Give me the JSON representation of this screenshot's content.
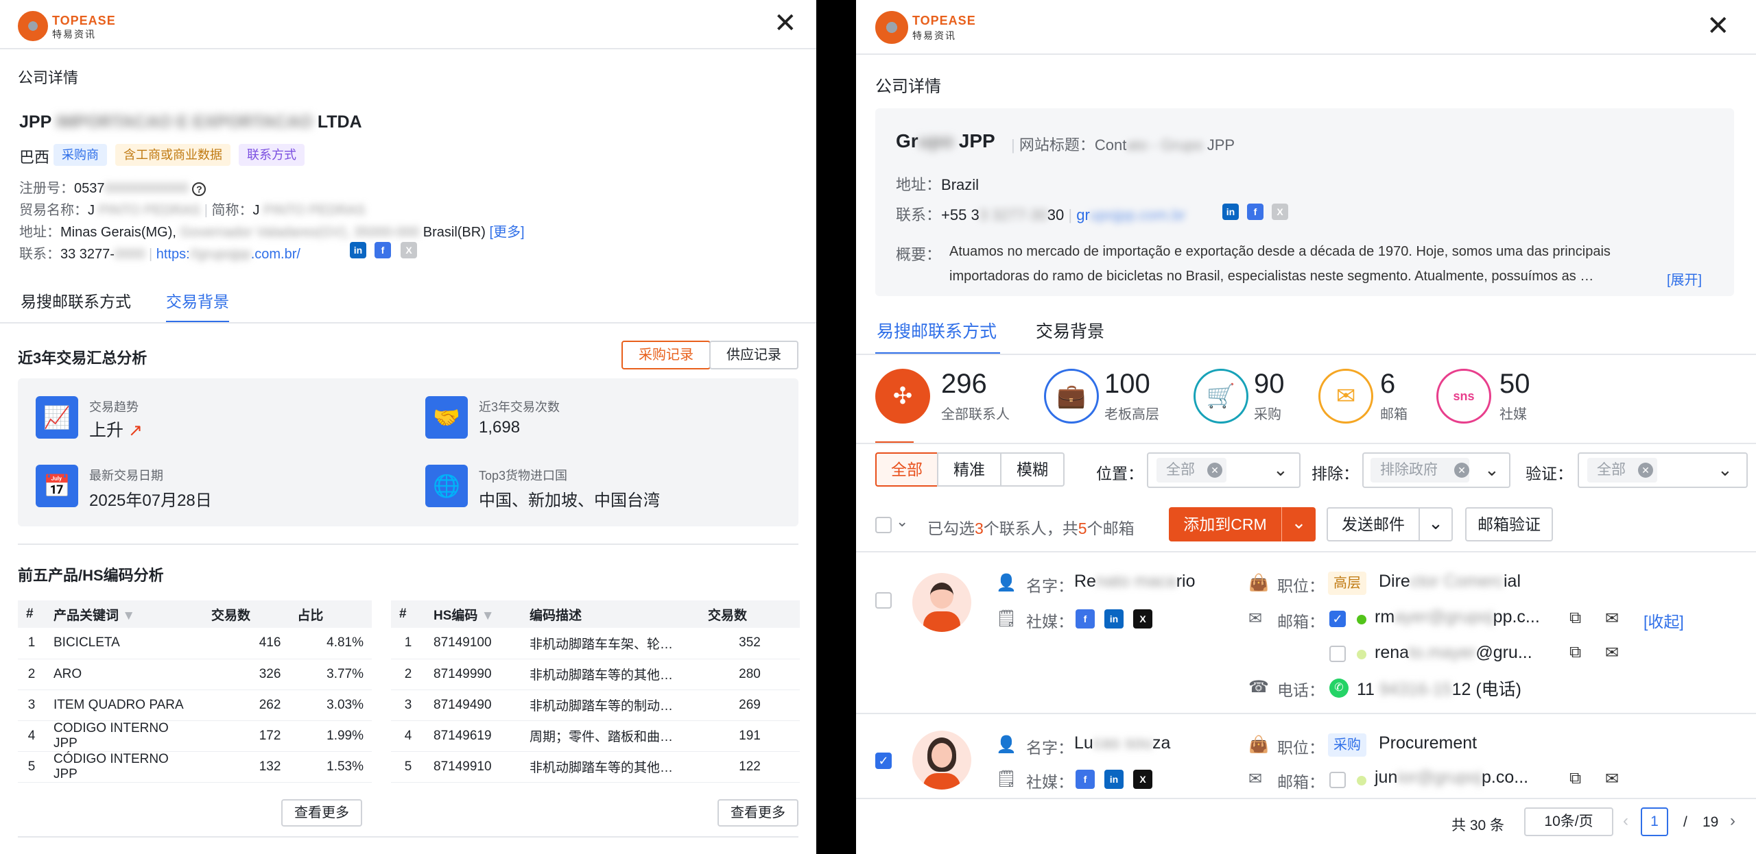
{
  "brand": {
    "name": "TOPEASE",
    "sub": "特易资讯"
  },
  "left": {
    "section_title": "公司详情",
    "company_prefix": "JPP",
    "company_blurred": "IMPORTACAO E EXPORTACAO",
    "company_suffix": "LTDA",
    "country": "巴西",
    "tags": [
      "采购商",
      "含工商或商业数据",
      "联系方式"
    ],
    "reg_label": "注册号：",
    "reg_value": "0537",
    "reg_blur": "00000000000",
    "trade_label": "贸易名称：",
    "trade_value": "J",
    "trade_blur": "PINTO PEDRAS",
    "short_label": "简称：",
    "short_value": "J",
    "short_blur": "PINTO PEDRAS",
    "addr_label": "地址：",
    "addr_value": "Minas Gerais(MG),",
    "addr_blur": "Governador Valadares(GV), 35000-000",
    "addr_country": "Brasil(BR)",
    "addr_more": "[更多]",
    "contact_label": "联系：",
    "contact_phone": "33 3277-",
    "contact_phone_blur": "0000",
    "contact_url_a": "https:",
    "contact_url_blur": "//grupojpp",
    "contact_url_b": ".com.br/",
    "tabs": [
      "易搜邮联系方式",
      "交易背景"
    ],
    "summary_title": "近3年交易汇总分析",
    "buttons": {
      "purchase": "采购记录",
      "supply": "供应记录"
    },
    "stats": [
      {
        "label": "交易趋势",
        "value": "上升",
        "icon": "chart-icon"
      },
      {
        "label": "近3年交易次数",
        "value": "1,698",
        "icon": "handshake-icon"
      },
      {
        "label": "最新交易日期",
        "value": "2025年07月28日",
        "icon": "calendar-icon"
      },
      {
        "label": "Top3货物进口国",
        "value": "中国、新加坡、中国台湾",
        "icon": "globe-icon"
      }
    ],
    "hs_title": "前五产品/HS编码分析",
    "table1": {
      "headers": [
        "#",
        "产品关键词",
        "交易数",
        "占比"
      ],
      "rows": [
        [
          "1",
          "BICICLETA",
          "416",
          "4.81%"
        ],
        [
          "2",
          "ARO",
          "326",
          "3.77%"
        ],
        [
          "3",
          "ITEM QUADRO PARA",
          "262",
          "3.03%"
        ],
        [
          "4",
          "CODIGO INTERNO JPP",
          "172",
          "1.99%"
        ],
        [
          "5",
          "CÓDIGO INTERNO JPP",
          "132",
          "1.53%"
        ]
      ]
    },
    "table2": {
      "headers": [
        "#",
        "HS编码",
        "编码描述",
        "交易数"
      ],
      "rows": [
        [
          "1",
          "87149100",
          "非机动脚踏车车架、轮…",
          "352"
        ],
        [
          "2",
          "87149990",
          "非机动脚踏车等的其他…",
          "280"
        ],
        [
          "3",
          "87149490",
          "非机动脚踏车等的制动…",
          "269"
        ],
        [
          "4",
          "87149619",
          "周期；零件、踏板和曲…",
          "191"
        ],
        [
          "5",
          "87149910",
          "非机动脚踏车等的其他…",
          "122"
        ]
      ]
    },
    "view_more": "查看更多"
  },
  "right": {
    "section_title": "公司详情",
    "company_a": "Gr",
    "company_blur": "upo",
    "company_b": "JPP",
    "site_label": "网站标题：",
    "site_a": "Cont",
    "site_blur": "ato - Grupo",
    "site_b": "JPP",
    "addr_label": "地址：",
    "addr_value": "Brazil",
    "contact_label": "联系：",
    "phone_a": "+55 3",
    "phone_blur": "3 3277-30",
    "phone_b": "30",
    "web_a": "gr",
    "web_blur": "upojpp.com.br",
    "summary_label": "概要：",
    "summary_line1": "Atuamos no mercado de importação e exportação desde a década de 1970. Hoje, somos uma das principais",
    "summary_line2": "importadoras do ramo de bicicletas no Brasil, especialistas neste segmento. Atualmente, possuímos as …",
    "expand": "[展开]",
    "tabs": [
      "易搜邮联系方式",
      "交易背景"
    ],
    "stats": [
      {
        "num": "296",
        "label": "全部联系人",
        "icon": "network-icon",
        "color": "#e8501c"
      },
      {
        "num": "100",
        "label": "老板高层",
        "icon": "boss-icon",
        "color": "#2f6fe8"
      },
      {
        "num": "90",
        "label": "采购",
        "icon": "cart-icon",
        "color": "#17a2b8"
      },
      {
        "num": "6",
        "label": "邮箱",
        "icon": "mail-icon",
        "color": "#f5a623"
      },
      {
        "num": "50",
        "label": "社媒",
        "icon": "sns-icon",
        "color": "#e83e8c"
      }
    ],
    "filters": {
      "all": "全部",
      "exact": "精准",
      "fuzzy": "模糊"
    },
    "position_label": "位置：",
    "position_chip": "全部",
    "exclude_label": "排除：",
    "exclude_chip": "排除政府",
    "verify_label": "验证：",
    "verify_chip": "全部",
    "selected_a": "已勾选",
    "selected_n1": "3",
    "selected_b": "个联系人，共",
    "selected_n2": "5",
    "selected_c": "个邮箱",
    "add_crm": "添加到CRM",
    "send_mail": "发送邮件",
    "verify_mail": "邮箱验证",
    "contacts": [
      {
        "name_label": "名字：",
        "name_a": "Re",
        "name_blur": "nato maca",
        "name_b": "rio",
        "social_label": "社媒：",
        "pos_label": "职位：",
        "pos_tag": "高层",
        "pos_a": "Dire",
        "pos_blur": "ctor Comerc",
        "pos_b": "ial",
        "mail_label": "邮箱：",
        "mail1": "rm",
        "mail1_blur": "ayer@grupoj",
        "mail1_b": "pp.c...",
        "mail2": "rena",
        "mail2_blur": "to.mayer",
        "mail2_b": "@gru...",
        "collapse": "[收起]",
        "phone_label": "电话：",
        "phone_a": "11",
        "phone_blur": "94316-15",
        "phone_b": "12 (电话)"
      },
      {
        "name_label": "名字：",
        "name_a": "Lu",
        "name_blur": "cas sou",
        "name_b": "za",
        "social_label": "社媒：",
        "pos_label": "职位：",
        "pos_tag": "采购",
        "pos_value": "Procurement",
        "mail_label": "邮箱：",
        "mail1": "jun",
        "mail1_blur": "ior@grupoj",
        "mail1_b": "p.co..."
      }
    ],
    "pager": {
      "total": "共 30 条",
      "per_page": "10条/页",
      "page": "1",
      "sep": "/",
      "pages": "19"
    }
  }
}
